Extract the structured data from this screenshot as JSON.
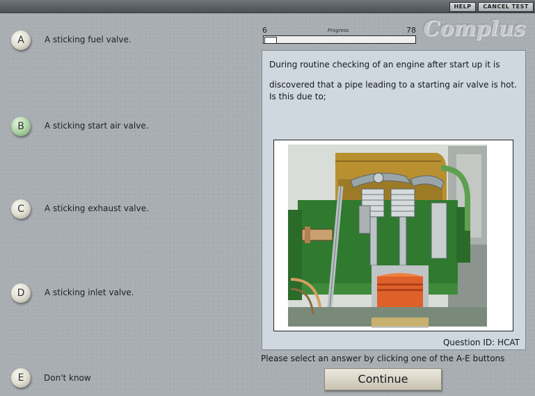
{
  "topbar": {
    "help_label": "HELP",
    "cancel_label": "CANCEL TEST"
  },
  "brand": {
    "name": "Complus"
  },
  "progress": {
    "start": "6",
    "label": "Progress",
    "total": "78",
    "fraction": 0.077
  },
  "answers": [
    {
      "letter": "A",
      "text": "A sticking fuel valve.",
      "selected": false
    },
    {
      "letter": "B",
      "text": "A sticking start air valve.",
      "selected": true
    },
    {
      "letter": "C",
      "text": "A sticking exhaust valve.",
      "selected": false
    },
    {
      "letter": "D",
      "text": "A sticking inlet valve.",
      "selected": false
    },
    {
      "letter": "E",
      "text": "Don't know",
      "selected": false
    }
  ],
  "question": {
    "line1": "During routine checking of an engine after start up it is",
    "line2": "discovered that a pipe leading to a starting air valve is hot. Is this due to;",
    "id_text": "Question ID: HCAT",
    "image_icon": "engine-cutaway-image"
  },
  "footer": {
    "instructions": "Please select an answer by clicking one of the A-E buttons",
    "continue_label": "Continue"
  },
  "colors": {
    "background": "#a9aeb3",
    "panel": "#cfd7df",
    "selected_button": "#a8cf9f",
    "engine_head": "#b89030",
    "engine_green": "#2f7a2f",
    "piston_orange": "#e0602a"
  }
}
